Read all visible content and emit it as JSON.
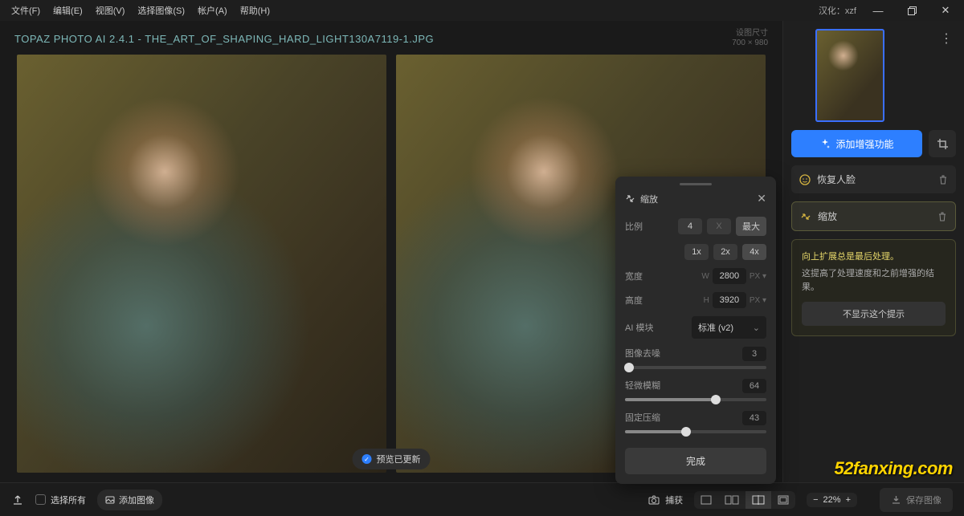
{
  "menubar": {
    "items": [
      "文件(F)",
      "编辑(E)",
      "视图(V)",
      "选择图像(S)",
      "帐户(A)",
      "帮助(H)"
    ],
    "lang_label": "汉化：xzf"
  },
  "title": "TOPAZ PHOTO AI 2.4.1 - THE_ART_OF_SHAPING_HARD_LIGHT130A7119-1.JPG",
  "dim_label": "设图尺寸",
  "dim_value": "700 × 980",
  "preview_chip": "预览已更新",
  "sidebar": {
    "add_enhance": "添加增强功能",
    "items": [
      {
        "icon": "face",
        "label": "恢复人脸"
      },
      {
        "icon": "scale",
        "label": "缩放"
      }
    ],
    "info_title": "向上扩展总是最后处理。",
    "info_body": "这提高了处理速度和之前增强的结果。",
    "info_btn": "不显示这个提示"
  },
  "bottombar": {
    "select_all": "选择所有",
    "add_images": "添加图像",
    "capture": "捕获",
    "zoom": "22%",
    "save": "保存图像"
  },
  "popup": {
    "title": "缩放",
    "ratio_label": "比例",
    "ratio_value": "4",
    "ratio_x": "X",
    "ratio_max": "最大",
    "presets": [
      "1x",
      "2x",
      "4x"
    ],
    "preset_active": 2,
    "width_label": "宽度",
    "width_value": "2800",
    "height_label": "高度",
    "height_value": "3920",
    "unit_w": "W",
    "unit_h": "H",
    "unit_px": "PX",
    "model_label": "AI 模块",
    "model_value": "标准 (v2)",
    "sliders": [
      {
        "label": "图像去噪",
        "value": 3,
        "max": 100
      },
      {
        "label": "轻微模糊",
        "value": 64,
        "max": 100
      },
      {
        "label": "固定压缩",
        "value": 43,
        "max": 100
      }
    ],
    "done": "完成"
  },
  "watermark": "52fanxing.com"
}
